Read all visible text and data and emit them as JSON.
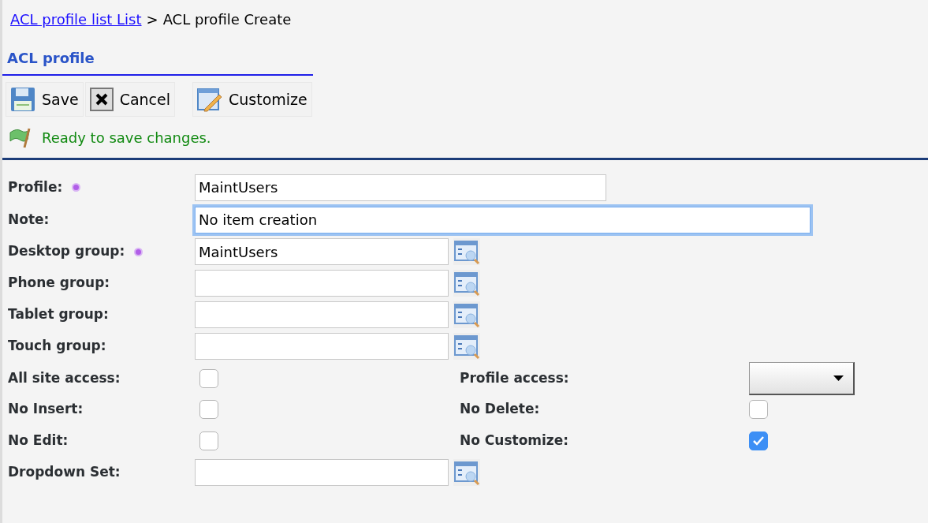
{
  "breadcrumb": {
    "link": "ACL profile list List",
    "separator": ">",
    "current": "ACL profile Create"
  },
  "section_title": "ACL profile",
  "toolbar": [
    {
      "kind": "save",
      "label": "Save"
    },
    {
      "kind": "cancel",
      "label": "Cancel"
    },
    {
      "kind": "customize",
      "label": "Customize"
    }
  ],
  "status": {
    "message": "Ready to save changes."
  },
  "form_rows": [
    {
      "kind": "text",
      "label": "Profile:",
      "required": true,
      "value": "MaintUsers",
      "focused": false
    },
    {
      "kind": "wide_text",
      "label": "Note:",
      "required": false,
      "value": "No item creation",
      "focused": true
    },
    {
      "kind": "lookup",
      "label": "Desktop group:",
      "required": true,
      "value": "MaintUsers"
    },
    {
      "kind": "lookup",
      "label": "Phone group:",
      "required": false,
      "value": ""
    },
    {
      "kind": "lookup",
      "label": "Tablet group:",
      "required": false,
      "value": ""
    },
    {
      "kind": "lookup",
      "label": "Touch group:",
      "required": false,
      "value": ""
    },
    {
      "kind": "pair",
      "left": {
        "label": "All site access:",
        "kind": "checkbox",
        "checked": false
      },
      "right": {
        "label": "Profile access:",
        "kind": "dropdown"
      }
    },
    {
      "kind": "pair",
      "left": {
        "label": "No Insert:",
        "kind": "checkbox",
        "checked": false
      },
      "right": {
        "label": "No Delete:",
        "kind": "checkbox",
        "checked": false
      }
    },
    {
      "kind": "pair",
      "left": {
        "label": "No Edit:",
        "kind": "checkbox",
        "checked": false
      },
      "right": {
        "label": "No Customize:",
        "kind": "checkbox",
        "checked": true
      }
    },
    {
      "kind": "lookup",
      "label": "Dropdown Set:",
      "required": false,
      "value": ""
    }
  ]
}
